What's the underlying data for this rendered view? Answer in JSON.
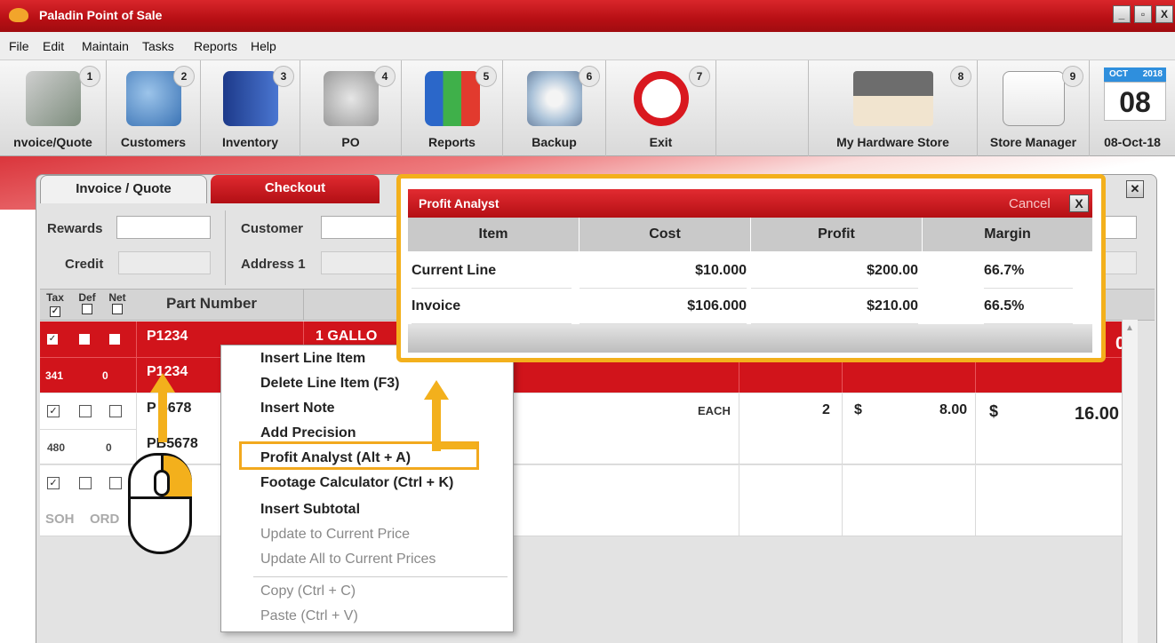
{
  "window": {
    "title": "Paladin Point of Sale",
    "buttons": [
      "_",
      "▫",
      "X"
    ]
  },
  "menu": [
    "File",
    "Edit",
    "Maintain",
    "Tasks",
    "Reports",
    "Help"
  ],
  "toolbar": [
    {
      "num": "1",
      "label": "nvoice/Quote",
      "icon": "cash-register-icon"
    },
    {
      "num": "2",
      "label": "Customers",
      "icon": "people-icon"
    },
    {
      "num": "3",
      "label": "Inventory",
      "icon": "book-tools-icon"
    },
    {
      "num": "4",
      "label": "PO",
      "icon": "gears-icon"
    },
    {
      "num": "5",
      "label": "Reports",
      "icon": "chart-icon"
    },
    {
      "num": "6",
      "label": "Backup",
      "icon": "disc-drive-icon"
    },
    {
      "num": "7",
      "label": "Exit",
      "icon": "no-sign-icon"
    },
    {
      "num": "8",
      "label": "My Hardware Store",
      "icon": "house-icon"
    },
    {
      "num": "9",
      "label": "Store Manager",
      "icon": "secure-badge-icon"
    }
  ],
  "calendar": {
    "month": "OCT",
    "year": "2018",
    "day": "08",
    "label": "08-Oct-18"
  },
  "tabs": {
    "invoice": "Invoice / Quote",
    "checkout": "Checkout"
  },
  "form": {
    "rewards": "Rewards",
    "credit": "Credit",
    "customer": "Customer",
    "address": "Address 1"
  },
  "grid_header": {
    "tax": "Tax",
    "def": "Def",
    "net": "Net",
    "part": "Part Number"
  },
  "rows": [
    {
      "part": "P1234",
      "desc": "1 GALLO",
      "part2": "P1234",
      "soh": "341",
      "ord": "0",
      "total_tail": "00"
    },
    {
      "part": "P 5678",
      "part2": "PB5678",
      "soh": "480",
      "ord": "0",
      "unit": "EACH",
      "qty": "2",
      "cur1": "$",
      "price": "8.00",
      "cur2": "$",
      "total": "16.00"
    },
    {
      "soh_label": "SOH",
      "ord_label": "ORD"
    }
  ],
  "context_menu": [
    {
      "label": "Insert Line Item",
      "enabled": true
    },
    {
      "label": "Delete Line Item (F3)",
      "enabled": true
    },
    {
      "label": "Insert Note",
      "enabled": true
    },
    {
      "label": "Add Precision",
      "enabled": true
    },
    {
      "label": "Profit Analyst (Alt + A)",
      "enabled": true
    },
    {
      "label": "Footage Calculator (Ctrl + K)",
      "enabled": true
    },
    {
      "label": "Insert Subtotal",
      "enabled": true
    },
    {
      "label": "Update to Current Price",
      "enabled": false
    },
    {
      "label": "Update All to Current Prices",
      "enabled": false
    },
    {
      "label": "Copy (Ctrl + C)",
      "enabled": false
    },
    {
      "label": "Paste (Ctrl + V)",
      "enabled": false
    }
  ],
  "profit_analyst": {
    "title": "Profit Analyst",
    "cancel": "Cancel",
    "close": "X",
    "columns": [
      "Item",
      "Cost",
      "Profit",
      "Margin"
    ],
    "rows": [
      {
        "item": "Current Line",
        "cost": "$10.000",
        "profit": "$200.00",
        "margin": "66.7%"
      },
      {
        "item": "Invoice",
        "cost": "$106.000",
        "profit": "$210.00",
        "margin": "66.5%"
      }
    ]
  },
  "colors": {
    "brand_red": "#d1141b",
    "highlight": "#f3b01c"
  }
}
